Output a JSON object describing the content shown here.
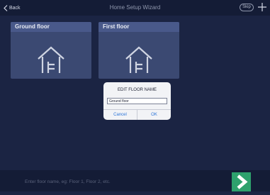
{
  "header": {
    "back_label": "Back",
    "title": "Home Setup Wizard",
    "skip_label": "Skip"
  },
  "floors": [
    {
      "name": "Ground floor"
    },
    {
      "name": "First floor"
    }
  ],
  "dialog": {
    "title": "EDIT FLOOR NAME",
    "input_value": "Ground floor",
    "cancel_label": "Cancel",
    "ok_label": "OK"
  },
  "footer": {
    "placeholder": "Enter floor name, eg: Floor 1, Floor 2, etc."
  },
  "colors": {
    "background": "#1b2443",
    "card": "#3b4972",
    "accent_green": "#2ea16d",
    "button_blue": "#2b74d8"
  },
  "icons": [
    "chevron-left-icon",
    "plus-icon",
    "house-icon",
    "arrow-right-icon"
  ]
}
